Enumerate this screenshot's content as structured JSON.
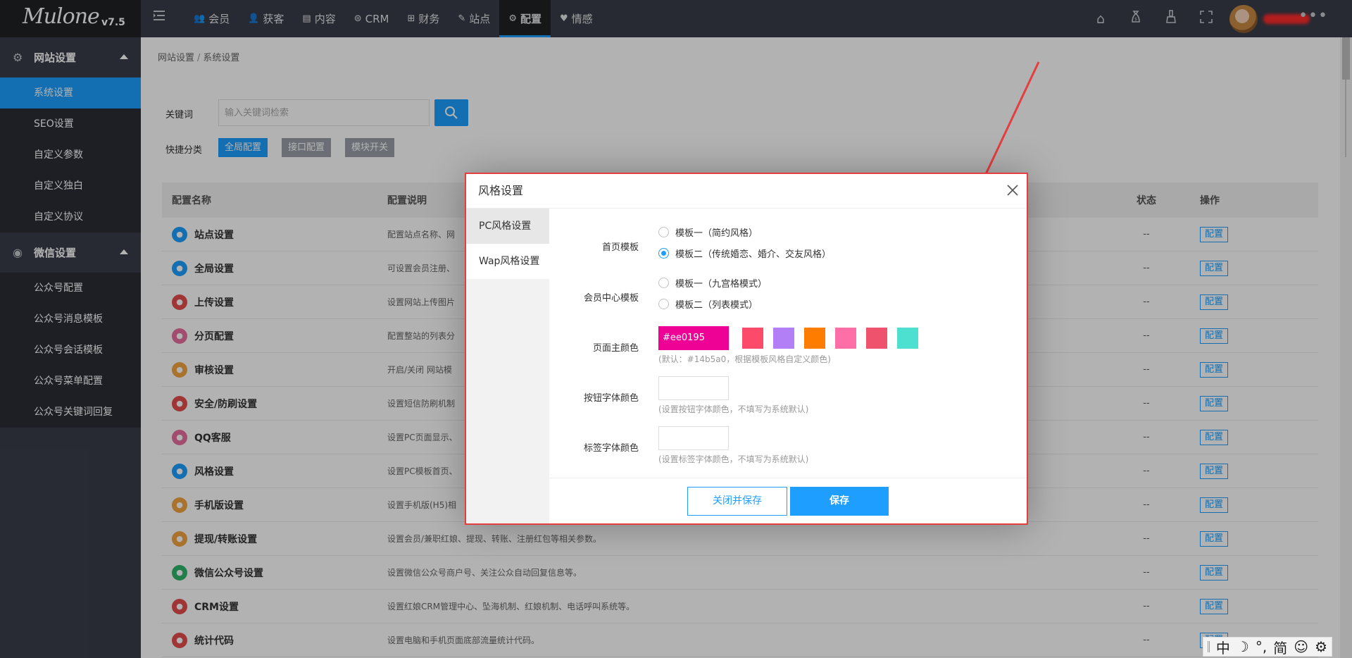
{
  "app": {
    "logo_text": "Mulone",
    "version": "v7.5"
  },
  "topnav": {
    "items": [
      {
        "label": "会员",
        "icon": "users-icon"
      },
      {
        "label": "获客",
        "icon": "user-plus-icon"
      },
      {
        "label": "内容",
        "icon": "content-icon"
      },
      {
        "label": "CRM",
        "icon": "crm-icon"
      },
      {
        "label": "财务",
        "icon": "finance-icon"
      },
      {
        "label": "站点",
        "icon": "site-icon"
      },
      {
        "label": "配置",
        "icon": "gear-icon"
      },
      {
        "label": "情感",
        "icon": "heart-icon"
      }
    ],
    "active_index": 6,
    "right_icons": [
      "home-icon",
      "money-bag-icon",
      "broom-icon",
      "fullscreen-icon"
    ]
  },
  "sidebar": {
    "groups": [
      {
        "label": "网站设置",
        "icon": "gear-icon",
        "items": [
          "系统设置",
          "SEO设置",
          "自定义参数",
          "自定义独白",
          "自定义协议"
        ]
      },
      {
        "label": "微信设置",
        "icon": "wechat-icon",
        "items": [
          "公众号配置",
          "公众号消息模板",
          "公众号会话模板",
          "公众号菜单配置",
          "公众号关键词回复"
        ]
      }
    ],
    "active_item": "系统设置"
  },
  "breadcrumb": {
    "items": [
      "网站设置",
      "系统设置"
    ],
    "separator": "/"
  },
  "search": {
    "label": "关键词",
    "placeholder": "输入关键词检索",
    "value": ""
  },
  "quick": {
    "label": "快捷分类",
    "buttons": [
      "全局配置",
      "接口配置",
      "模块开关"
    ],
    "active_index": 0
  },
  "table": {
    "headers": [
      "配置名称",
      "配置说明",
      "状态",
      "操作"
    ],
    "rows": [
      {
        "name": "站点设置",
        "desc": "配置站点名称、网",
        "status": "--",
        "action": "配置",
        "color": "#1e9fff"
      },
      {
        "name": "全局设置",
        "desc": "可设置会员注册、",
        "status": "--",
        "action": "配置",
        "color": "#1e9fff"
      },
      {
        "name": "上传设置",
        "desc": "设置网站上传图片",
        "status": "--",
        "action": "配置",
        "color": "#e64c4c"
      },
      {
        "name": "分页配置",
        "desc": "配置整站的列表分",
        "status": "--",
        "action": "配置",
        "color": "#e86f9f"
      },
      {
        "name": "审核设置",
        "desc": "开启/关闭 网站模",
        "status": "--",
        "action": "配置",
        "color": "#f2a541"
      },
      {
        "name": "安全/防刷设置",
        "desc": "设置短信防刷机制",
        "status": "--",
        "action": "配置",
        "color": "#e64c4c"
      },
      {
        "name": "QQ客服",
        "desc": "设置PC页面显示、",
        "status": "--",
        "action": "配置",
        "color": "#e86f9f"
      },
      {
        "name": "风格设置",
        "desc": "设置PC模板首页、",
        "status": "--",
        "action": "配置",
        "color": "#1e9fff"
      },
      {
        "name": "手机版设置",
        "desc": "设置手机版(H5)相",
        "status": "--",
        "action": "配置",
        "color": "#f2a541"
      },
      {
        "name": "提现/转账设置",
        "desc": "设置会员/兼职红娘、提现、转账、注册红包等相关参数。",
        "status": "--",
        "action": "配置",
        "color": "#f2a541"
      },
      {
        "name": "微信公众号设置",
        "desc": "设置微信公众号商户号、关注公众自动回复信息等。",
        "status": "--",
        "action": "配置",
        "color": "#2fb56a"
      },
      {
        "name": "CRM设置",
        "desc": "设置红娘CRM管理中心、坠海机制、红娘机制、电话呼叫系统等。",
        "status": "--",
        "action": "配置",
        "color": "#e64c4c"
      },
      {
        "name": "统计代码",
        "desc": "设置电脑和手机页面底部流量统计代码。",
        "status": "--",
        "action": "配置",
        "color": "#e64c4c"
      }
    ]
  },
  "dialog": {
    "title": "风格设置",
    "tabs": [
      "PC风格设置",
      "Wap风格设置"
    ],
    "active_tab": 0,
    "home_template": {
      "label": "首页模板",
      "options": [
        "模板一（简约风格）",
        "模板二（传统婚恋、婚介、交友风格）"
      ],
      "selected": 1
    },
    "member_template": {
      "label": "会员中心模板",
      "options": [
        "模板一（九宫格模式）",
        "模板二（列表模式）"
      ],
      "selected": null
    },
    "theme_color": {
      "label": "页面主颜色",
      "value": "#ee0195",
      "swatches": [
        "#fc4a6b",
        "#b37ff7",
        "#fe7d00",
        "#ff6fa7",
        "#ef526d",
        "#4ddfcf"
      ],
      "hint": "(默认：#14b5a0，根据模板风格自定义颜色)"
    },
    "button_text_color": {
      "label": "按钮字体颜色",
      "value": "",
      "hint": "(设置按钮字体颜色，不填写为系统默认)"
    },
    "label_text_color": {
      "label": "标签字体颜色",
      "value": "",
      "hint": "(设置标签字体颜色，不填写为系统默认)"
    },
    "buttons": {
      "close_save": "关闭并保存",
      "save": "保存"
    }
  },
  "ime": {
    "items": [
      "中",
      "☽",
      "°,",
      "简",
      "☺",
      "⚙"
    ]
  },
  "colors": {
    "accent": "#1e9fff",
    "topbar": "#393d49",
    "sidebar_dark": "#2a2d35",
    "highlight": "#e53e3e"
  }
}
